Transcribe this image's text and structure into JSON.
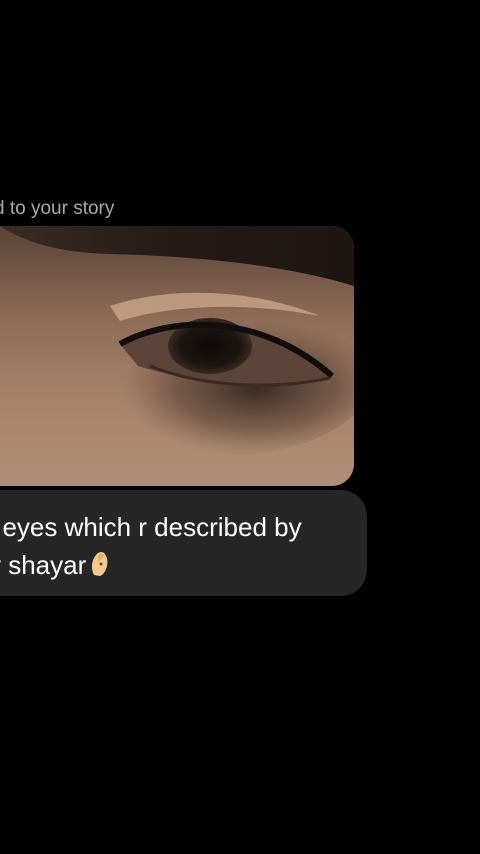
{
  "conversation": {
    "story_reply_caption": "d to your story",
    "story_image_icon": "eye-photo",
    "message_line1": "t eyes which r described by",
    "message_line2": "y shayar",
    "message_emoji": "pinched-fingers",
    "colors": {
      "background": "#000000",
      "bubble": "#262626",
      "caption_text": "#a8a8a8",
      "message_text": "#ffffff"
    }
  }
}
